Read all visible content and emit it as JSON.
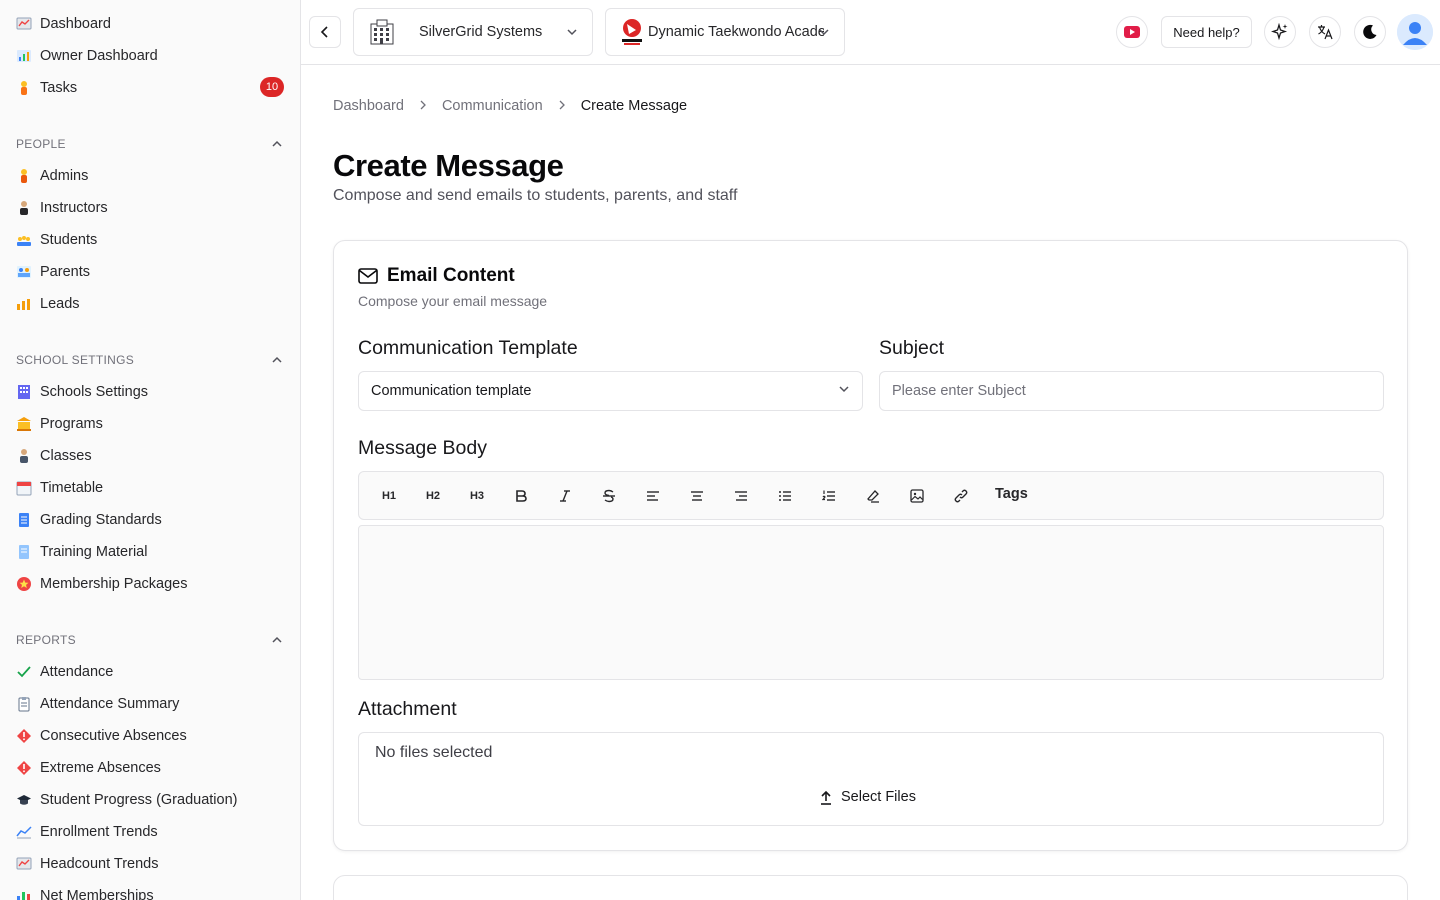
{
  "sidebar": {
    "top_items": [
      {
        "label": "Dashboard",
        "icon": "dashboard-icon"
      },
      {
        "label": "Owner Dashboard",
        "icon": "owner-dashboard-icon"
      },
      {
        "label": "Tasks",
        "icon": "tasks-icon",
        "badge": "10"
      }
    ],
    "sections": [
      {
        "title": "PEOPLE",
        "items": [
          {
            "label": "Admins",
            "icon": "admin-icon"
          },
          {
            "label": "Instructors",
            "icon": "instructor-icon"
          },
          {
            "label": "Students",
            "icon": "students-icon"
          },
          {
            "label": "Parents",
            "icon": "parents-icon"
          },
          {
            "label": "Leads",
            "icon": "leads-icon"
          }
        ]
      },
      {
        "title": "SCHOOL SETTINGS",
        "items": [
          {
            "label": "Schools Settings",
            "icon": "building-icon"
          },
          {
            "label": "Programs",
            "icon": "programs-icon"
          },
          {
            "label": "Classes",
            "icon": "classes-icon"
          },
          {
            "label": "Timetable",
            "icon": "calendar-icon"
          },
          {
            "label": "Grading Standards",
            "icon": "grading-icon"
          },
          {
            "label": "Training Material",
            "icon": "document-icon"
          },
          {
            "label": "Membership Packages",
            "icon": "membership-icon"
          }
        ]
      },
      {
        "title": "REPORTS",
        "items": [
          {
            "label": "Attendance",
            "icon": "check-icon"
          },
          {
            "label": "Attendance Summary",
            "icon": "clipboard-icon"
          },
          {
            "label": "Consecutive Absences",
            "icon": "warning-diamond-icon"
          },
          {
            "label": "Extreme Absences",
            "icon": "warning-diamond-icon"
          },
          {
            "label": "Student Progress (Graduation)",
            "icon": "graduation-cap-icon"
          },
          {
            "label": "Enrollment Trends",
            "icon": "trend-chart-icon"
          },
          {
            "label": "Headcount Trends",
            "icon": "chart-icon"
          },
          {
            "label": "Net Memberships",
            "icon": "bar-chart-icon"
          }
        ]
      }
    ]
  },
  "topbar": {
    "organization": "SilverGrid Systems",
    "school": "Dynamic Taekwondo Academy",
    "help_label": "Need help?"
  },
  "breadcrumb": [
    "Dashboard",
    "Communication",
    "Create Message"
  ],
  "page": {
    "title": "Create Message",
    "subtitle": "Compose and send emails to students, parents, and staff"
  },
  "card": {
    "title": "Email Content",
    "subtitle": "Compose your email message",
    "template_label": "Communication Template",
    "template_value": "Communication template",
    "subject_label": "Subject",
    "subject_placeholder": "Please enter Subject",
    "body_label": "Message Body",
    "toolbar": {
      "h1": "H1",
      "h2": "H2",
      "h3": "H3",
      "tags": "Tags"
    },
    "attachment_label": "Attachment",
    "no_files": "No files selected",
    "select_files": "Select Files"
  },
  "colors": {
    "badge": "#dc2626",
    "youtube": "#e11d48",
    "avatar": "#3b82f6"
  }
}
